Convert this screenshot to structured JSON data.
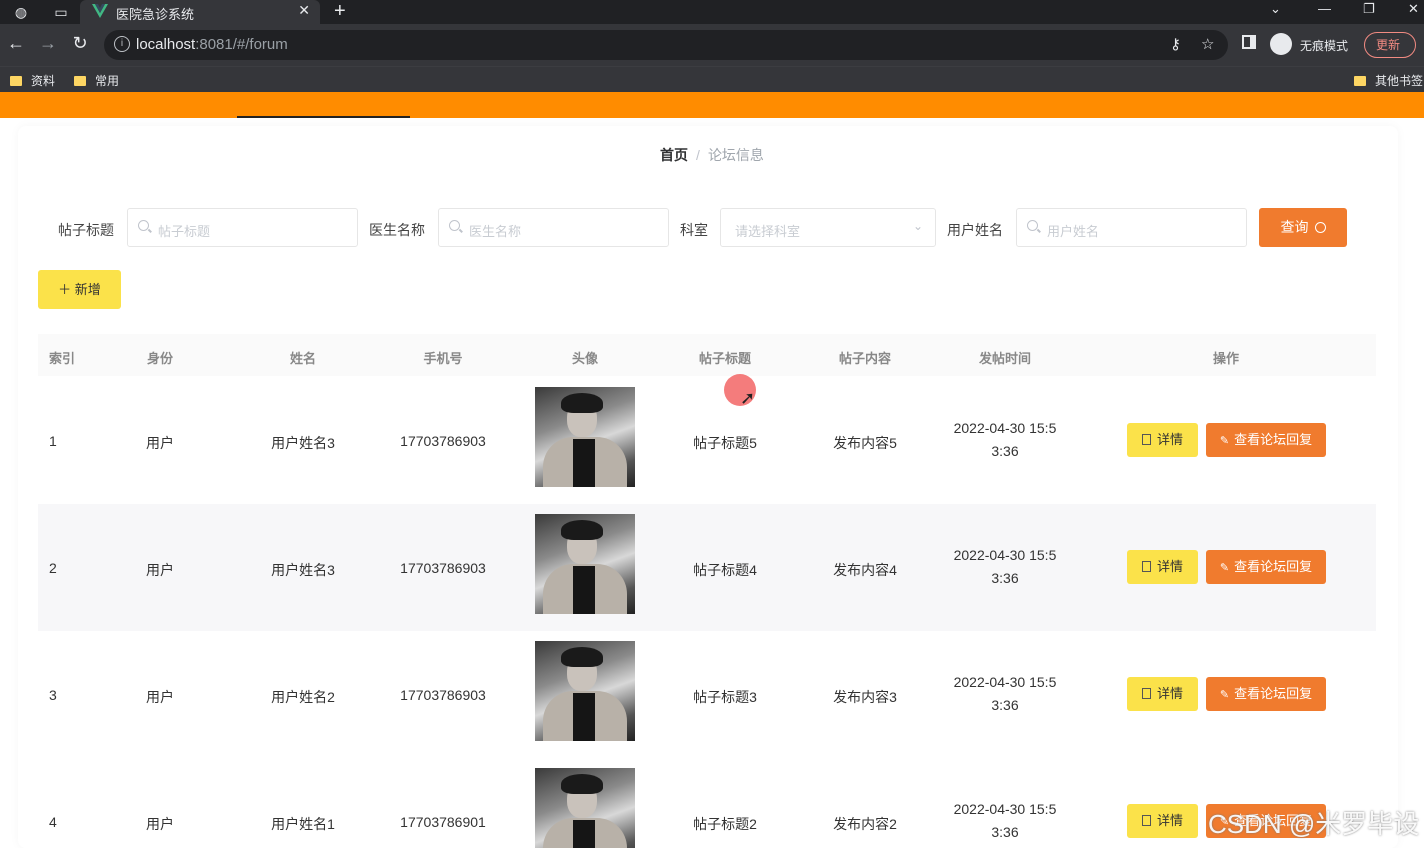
{
  "browser": {
    "tab_title": "医院急诊系统",
    "url_host": "localhost",
    "url_rest": ":8081/#/forum",
    "incognito_label": "无痕模式",
    "update_label": "更新",
    "bookmarks": [
      "资料",
      "常用"
    ],
    "other_bookmarks": "其他书签"
  },
  "breadcrumb": {
    "home": "首页",
    "sep": "/",
    "current": "论坛信息"
  },
  "filters": {
    "title_label": "帖子标题",
    "title_placeholder": "帖子标题",
    "doctor_label": "医生名称",
    "doctor_placeholder": "医生名称",
    "dept_label": "科室",
    "dept_placeholder": "请选择科室",
    "user_label": "用户姓名",
    "user_placeholder": "用户姓名",
    "query_label": "查询"
  },
  "add_label": "新增",
  "table": {
    "headers": [
      "索引",
      "身份",
      "姓名",
      "手机号",
      "头像",
      "帖子标题",
      "帖子内容",
      "发帖时间",
      "操作"
    ],
    "rows": [
      {
        "index": "1",
        "role": "用户",
        "name": "用户姓名3",
        "phone": "17703786903",
        "title": "帖子标题5",
        "content": "发布内容5",
        "time1": "2022-04-30 15:5",
        "time2": "3:36"
      },
      {
        "index": "2",
        "role": "用户",
        "name": "用户姓名3",
        "phone": "17703786903",
        "title": "帖子标题4",
        "content": "发布内容4",
        "time1": "2022-04-30 15:5",
        "time2": "3:36"
      },
      {
        "index": "3",
        "role": "用户",
        "name": "用户姓名2",
        "phone": "17703786903",
        "title": "帖子标题3",
        "content": "发布内容3",
        "time1": "2022-04-30 15:5",
        "time2": "3:36"
      },
      {
        "index": "4",
        "role": "用户",
        "name": "用户姓名1",
        "phone": "17703786901",
        "title": "帖子标题2",
        "content": "发布内容2",
        "time1": "2022-04-30 15:5",
        "time2": "3:36"
      }
    ],
    "detail_label": "详情",
    "reply_label": "查看论坛回复"
  },
  "watermark": "CSDN @米罗毕设",
  "colors": {
    "accent_orange": "#ff8c00",
    "button_orange": "#f07b2e",
    "button_yellow": "#fbe24a"
  }
}
